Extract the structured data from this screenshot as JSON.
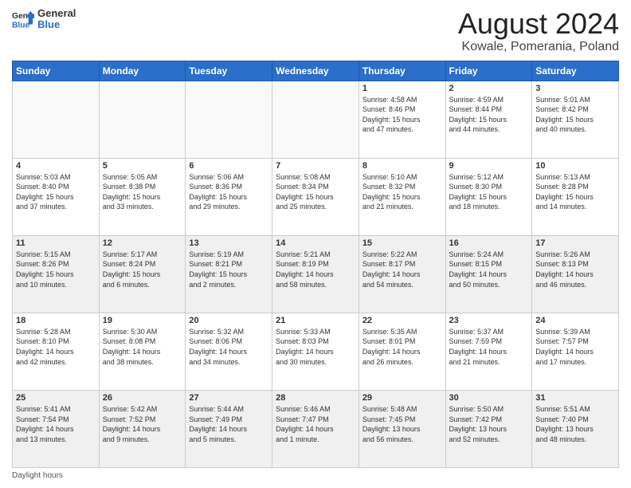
{
  "logo": {
    "general": "General",
    "blue": "Blue"
  },
  "header": {
    "month": "August 2024",
    "location": "Kowale, Pomerania, Poland"
  },
  "weekdays": [
    "Sunday",
    "Monday",
    "Tuesday",
    "Wednesday",
    "Thursday",
    "Friday",
    "Saturday"
  ],
  "weeks": [
    [
      {
        "day": "",
        "info": ""
      },
      {
        "day": "",
        "info": ""
      },
      {
        "day": "",
        "info": ""
      },
      {
        "day": "",
        "info": ""
      },
      {
        "day": "1",
        "info": "Sunrise: 4:58 AM\nSunset: 8:46 PM\nDaylight: 15 hours\nand 47 minutes."
      },
      {
        "day": "2",
        "info": "Sunrise: 4:59 AM\nSunset: 8:44 PM\nDaylight: 15 hours\nand 44 minutes."
      },
      {
        "day": "3",
        "info": "Sunrise: 5:01 AM\nSunset: 8:42 PM\nDaylight: 15 hours\nand 40 minutes."
      }
    ],
    [
      {
        "day": "4",
        "info": "Sunrise: 5:03 AM\nSunset: 8:40 PM\nDaylight: 15 hours\nand 37 minutes."
      },
      {
        "day": "5",
        "info": "Sunrise: 5:05 AM\nSunset: 8:38 PM\nDaylight: 15 hours\nand 33 minutes."
      },
      {
        "day": "6",
        "info": "Sunrise: 5:06 AM\nSunset: 8:36 PM\nDaylight: 15 hours\nand 29 minutes."
      },
      {
        "day": "7",
        "info": "Sunrise: 5:08 AM\nSunset: 8:34 PM\nDaylight: 15 hours\nand 25 minutes."
      },
      {
        "day": "8",
        "info": "Sunrise: 5:10 AM\nSunset: 8:32 PM\nDaylight: 15 hours\nand 21 minutes."
      },
      {
        "day": "9",
        "info": "Sunrise: 5:12 AM\nSunset: 8:30 PM\nDaylight: 15 hours\nand 18 minutes."
      },
      {
        "day": "10",
        "info": "Sunrise: 5:13 AM\nSunset: 8:28 PM\nDaylight: 15 hours\nand 14 minutes."
      }
    ],
    [
      {
        "day": "11",
        "info": "Sunrise: 5:15 AM\nSunset: 8:26 PM\nDaylight: 15 hours\nand 10 minutes."
      },
      {
        "day": "12",
        "info": "Sunrise: 5:17 AM\nSunset: 8:24 PM\nDaylight: 15 hours\nand 6 minutes."
      },
      {
        "day": "13",
        "info": "Sunrise: 5:19 AM\nSunset: 8:21 PM\nDaylight: 15 hours\nand 2 minutes."
      },
      {
        "day": "14",
        "info": "Sunrise: 5:21 AM\nSunset: 8:19 PM\nDaylight: 14 hours\nand 58 minutes."
      },
      {
        "day": "15",
        "info": "Sunrise: 5:22 AM\nSunset: 8:17 PM\nDaylight: 14 hours\nand 54 minutes."
      },
      {
        "day": "16",
        "info": "Sunrise: 5:24 AM\nSunset: 8:15 PM\nDaylight: 14 hours\nand 50 minutes."
      },
      {
        "day": "17",
        "info": "Sunrise: 5:26 AM\nSunset: 8:13 PM\nDaylight: 14 hours\nand 46 minutes."
      }
    ],
    [
      {
        "day": "18",
        "info": "Sunrise: 5:28 AM\nSunset: 8:10 PM\nDaylight: 14 hours\nand 42 minutes."
      },
      {
        "day": "19",
        "info": "Sunrise: 5:30 AM\nSunset: 8:08 PM\nDaylight: 14 hours\nand 38 minutes."
      },
      {
        "day": "20",
        "info": "Sunrise: 5:32 AM\nSunset: 8:06 PM\nDaylight: 14 hours\nand 34 minutes."
      },
      {
        "day": "21",
        "info": "Sunrise: 5:33 AM\nSunset: 8:03 PM\nDaylight: 14 hours\nand 30 minutes."
      },
      {
        "day": "22",
        "info": "Sunrise: 5:35 AM\nSunset: 8:01 PM\nDaylight: 14 hours\nand 26 minutes."
      },
      {
        "day": "23",
        "info": "Sunrise: 5:37 AM\nSunset: 7:59 PM\nDaylight: 14 hours\nand 21 minutes."
      },
      {
        "day": "24",
        "info": "Sunrise: 5:39 AM\nSunset: 7:57 PM\nDaylight: 14 hours\nand 17 minutes."
      }
    ],
    [
      {
        "day": "25",
        "info": "Sunrise: 5:41 AM\nSunset: 7:54 PM\nDaylight: 14 hours\nand 13 minutes."
      },
      {
        "day": "26",
        "info": "Sunrise: 5:42 AM\nSunset: 7:52 PM\nDaylight: 14 hours\nand 9 minutes."
      },
      {
        "day": "27",
        "info": "Sunrise: 5:44 AM\nSunset: 7:49 PM\nDaylight: 14 hours\nand 5 minutes."
      },
      {
        "day": "28",
        "info": "Sunrise: 5:46 AM\nSunset: 7:47 PM\nDaylight: 14 hours\nand 1 minute."
      },
      {
        "day": "29",
        "info": "Sunrise: 5:48 AM\nSunset: 7:45 PM\nDaylight: 13 hours\nand 56 minutes."
      },
      {
        "day": "30",
        "info": "Sunrise: 5:50 AM\nSunset: 7:42 PM\nDaylight: 13 hours\nand 52 minutes."
      },
      {
        "day": "31",
        "info": "Sunrise: 5:51 AM\nSunset: 7:40 PM\nDaylight: 13 hours\nand 48 minutes."
      }
    ]
  ],
  "footer": {
    "daylight_label": "Daylight hours"
  }
}
